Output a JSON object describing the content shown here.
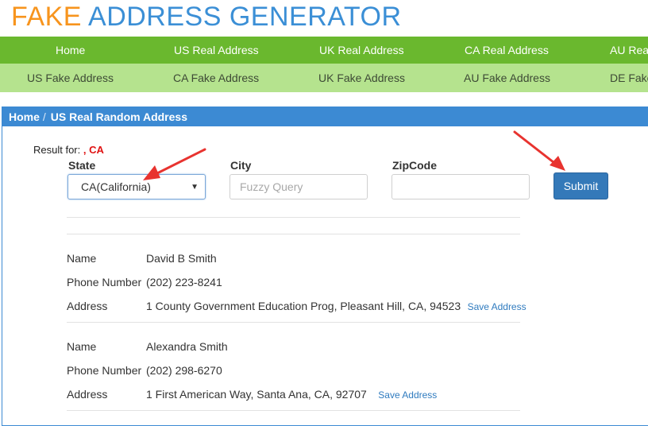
{
  "logo": {
    "part1": "FAKE",
    "part2": "ADDRESS GENERATOR"
  },
  "nav_primary": [
    "Home",
    "US Real Address",
    "UK Real Address",
    "CA Real Address",
    "AU Real Address"
  ],
  "nav_secondary": [
    "US Fake Address",
    "CA Fake Address",
    "UK Fake Address",
    "AU Fake Address",
    "DE Fake Address"
  ],
  "breadcrumb": {
    "home": "Home",
    "separator": "/",
    "current": "US Real Random Address"
  },
  "result": {
    "label": "Result for:",
    "value": ", CA"
  },
  "form": {
    "state_label": "State",
    "state_value": "CA(California)",
    "city_label": "City",
    "city_placeholder": "Fuzzy Query",
    "zip_label": "ZipCode",
    "zip_value": "",
    "submit_label": "Submit"
  },
  "field_labels": {
    "name": "Name",
    "phone": "Phone Number",
    "address": "Address"
  },
  "save_label": "Save Address",
  "records": [
    {
      "name": "David B Smith",
      "phone": "(202) 223-8241",
      "address": "1 County Government Education Prog, Pleasant Hill, CA, 94523"
    },
    {
      "name": "Alexandra Smith",
      "phone": "(202) 298-6270",
      "address": "1 First American Way, Santa Ana, CA, 92707"
    }
  ],
  "colors": {
    "logo_orange": "#f7941d",
    "logo_blue": "#3b8fd6",
    "nav_primary_bg": "#6ab82e",
    "nav_secondary_bg": "#b5e38e",
    "panel_header": "#3c8ad3",
    "submit_bg": "#3479b9",
    "annotation_arrow": "#e8332f",
    "result_red": "#e01212",
    "link": "#2f7bbf"
  }
}
